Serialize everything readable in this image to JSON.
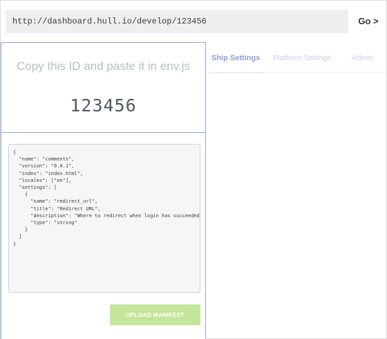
{
  "url_bar": {
    "url": "http://dashboard.hull.io/develop/123456",
    "go_label": "Go >"
  },
  "tabs": [
    {
      "label": "Ship Settings",
      "active": true
    },
    {
      "label": "Platform Settings",
      "active": false
    },
    {
      "label": "Admin",
      "active": false
    }
  ],
  "id_panel": {
    "instruction": "Copy this ID and paste it in env.js",
    "app_id": "123456"
  },
  "manifest": {
    "content": "{\n  \"name\": \"comments\",\n  \"version\": \"0.0.1\",\n  \"index\": \"index.html\",\n  \"locales\": [\"en\"],\n  \"settings\": [\n    {\n      \"name\": \"redirect_url\",\n      \"title\": \"Redirect URL\",\n      \"description\": \"Where to redirect when login has succeeded\",\n      \"type\": \"string\"\n    }\n  ]\n}"
  },
  "upload_button": {
    "label": "UPLOAD MANIFEST"
  },
  "colors": {
    "panel_border": "#8fa8d4",
    "upload_button": "#c4e59a",
    "id_text": "#4f5865"
  }
}
